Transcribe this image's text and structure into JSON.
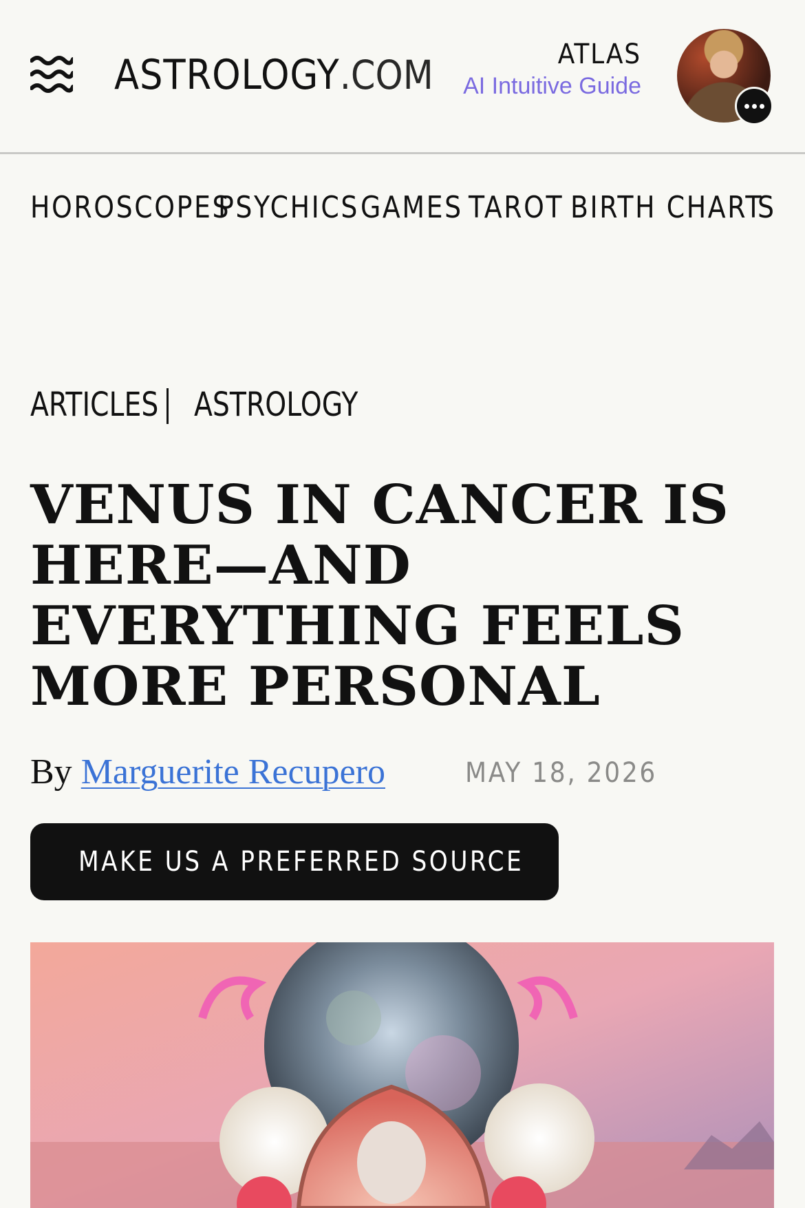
{
  "header": {
    "logo_main": "ASTROLOGY",
    "logo_tld": ".COM",
    "atlas_name": "ATLAS",
    "atlas_subtitle": "AI Intuitive Guide"
  },
  "nav": {
    "items": [
      "HOROSCOPES",
      "PSYCHICS",
      "GAMES",
      "TAROT",
      "BIRTH CHART",
      "S"
    ]
  },
  "breadcrumb": {
    "items": [
      "ARTICLES",
      "ASTROLOGY"
    ]
  },
  "article": {
    "title": "Venus in Cancer Is Here—and Everything Feels More Personal",
    "byline_prefix": "By",
    "author": "Marguerite Recupero",
    "date": "MAY 18, 2026"
  },
  "cta": {
    "label": "MAKE US A PREFERRED SOURCE",
    "icon": "google-g-icon"
  },
  "colors": {
    "background": "#f8f8f4",
    "accent_purple": "#7a6ae0",
    "link_blue": "#3b73d6",
    "button_bg": "#111111"
  }
}
